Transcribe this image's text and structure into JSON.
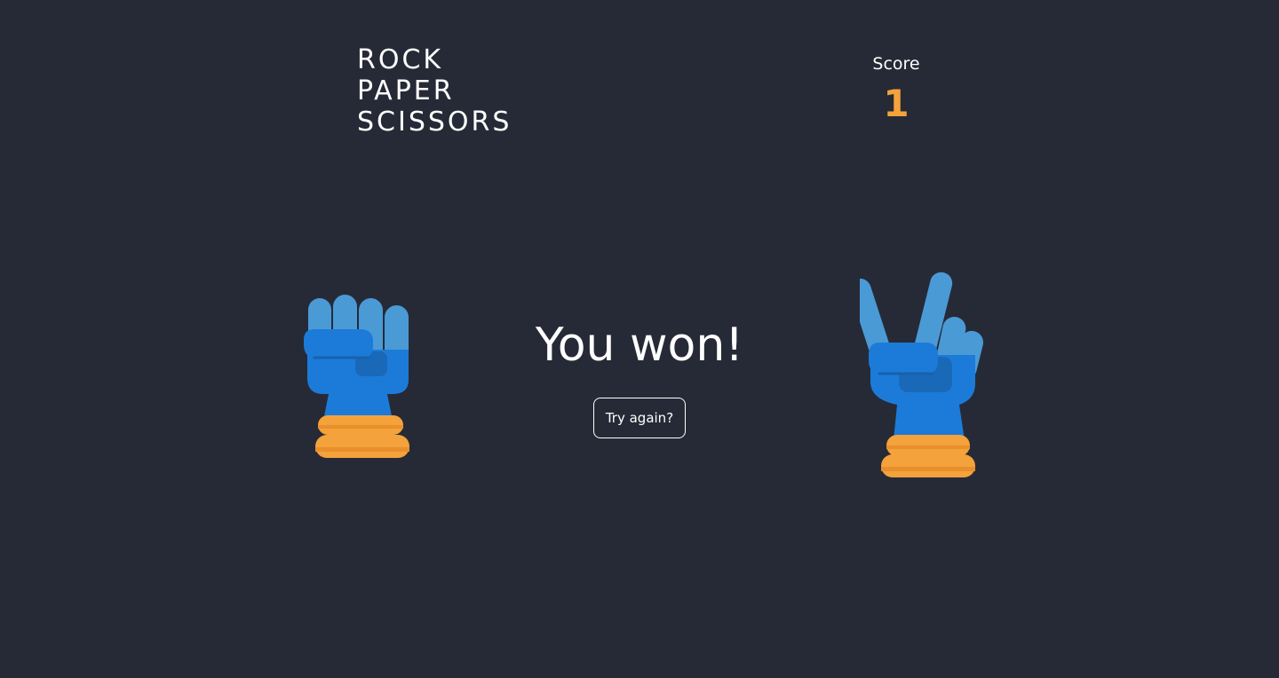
{
  "header": {
    "logo_lines": [
      "ROCK",
      "PAPER",
      "SCISSORS"
    ],
    "score_label": "Score",
    "score_value": "1"
  },
  "game": {
    "player_choice": "rock",
    "opponent_choice": "scissors",
    "result_text": "You won!",
    "try_again_label": "Try again?"
  },
  "colors": {
    "background": "#262a36",
    "text": "#ffffff",
    "score_accent": "#f4a23b",
    "glove_blue": "#1c7bd9",
    "glove_blue_light": "#4a9ad6",
    "cuff_orange": "#f4a23b"
  },
  "icons": {
    "player_hand": "rock-fist-icon",
    "opponent_hand": "scissors-peace-icon"
  }
}
